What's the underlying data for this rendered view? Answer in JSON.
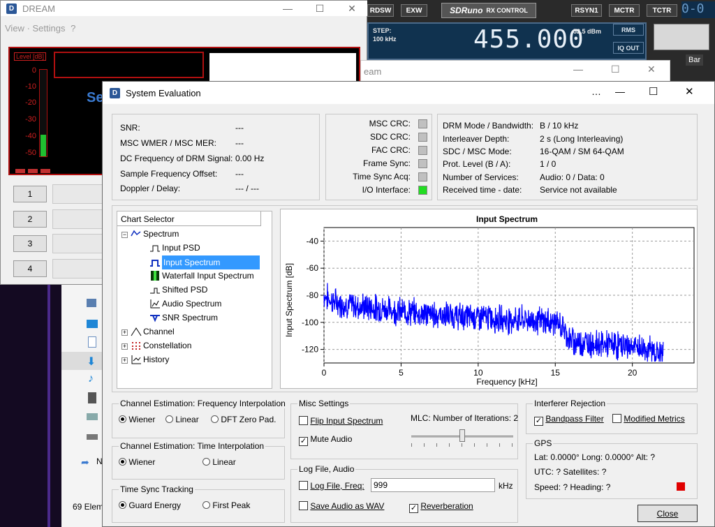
{
  "dream_window": {
    "title": "DREAM",
    "menu": [
      "View",
      "Settings",
      "?"
    ],
    "level_label": "Level [dB]",
    "level_ticks": [
      "0",
      "-10",
      "-20",
      "-30",
      "-40",
      "-50"
    ],
    "level_value_db": -45,
    "partial_text": "Se",
    "service_buttons": [
      "1",
      "2",
      "3",
      "4"
    ]
  },
  "sdruno": {
    "buttons_top": [
      "RDSW",
      "EXW"
    ],
    "logo": "SDRuno",
    "logo_sub": "RX CONTROL",
    "buttons_right": [
      "RSYN1",
      "MCTR",
      "TCTR"
    ],
    "step_label": "STEP:",
    "step_value": "100 kHz",
    "frequency": "455.000",
    "signal": "-52,5 dBm",
    "rms_button": "RMS",
    "iqout_button": "IQ OUT",
    "partial_bar": "Bar",
    "digits_partial": "0-0"
  },
  "second_dream_partial_title": "eam",
  "explorer": {
    "items_count": "69 Elem",
    "partial_letter": "N"
  },
  "system_evaluation": {
    "title": "System Evaluation",
    "stats": [
      {
        "label": "SNR:",
        "value": "---"
      },
      {
        "label": "MSC WMER / MSC MER:",
        "value": "---"
      },
      {
        "label": "DC Frequency of DRM Signal:",
        "value": "0.00 Hz"
      },
      {
        "label": "Sample Frequency Offset:",
        "value": "---"
      },
      {
        "label": "Doppler / Delay:",
        "value": "--- / ---"
      }
    ],
    "crc": [
      {
        "label": "MSC CRC:",
        "color": "#c0c0c0"
      },
      {
        "label": "SDC CRC:",
        "color": "#c0c0c0"
      },
      {
        "label": "FAC CRC:",
        "color": "#c0c0c0"
      },
      {
        "label": "Frame Sync:",
        "color": "#c0c0c0"
      },
      {
        "label": "Time Sync Acq:",
        "color": "#c0c0c0"
      },
      {
        "label": "I/O Interface:",
        "color": "#22dd22"
      }
    ],
    "drm_info": [
      {
        "label": "DRM Mode / Bandwidth:",
        "value": "B / 10 kHz"
      },
      {
        "label": "Interleaver Depth:",
        "value": "2 s (Long Interleaving)"
      },
      {
        "label": "SDC / MSC Mode:",
        "value": "16-QAM / SM 64-QAM"
      },
      {
        "label": "Prot. Level (B / A):",
        "value": "1 / 0"
      },
      {
        "label": "Number of Services:",
        "value": "Audio: 0 / Data: 0"
      },
      {
        "label": "Received time - date:",
        "value": "Service not available"
      }
    ],
    "chart_selector": {
      "header": "Chart Selector",
      "nodes": [
        {
          "label": "Spectrum",
          "expander": "-",
          "icon": "spectrum-icon"
        },
        {
          "label": "Input PSD",
          "icon": "input-psd-icon"
        },
        {
          "label": "Input Spectrum",
          "icon": "input-spectrum-icon",
          "selected": true
        },
        {
          "label": "Waterfall Input Spectrum",
          "icon": "waterfall-icon"
        },
        {
          "label": "Shifted PSD",
          "icon": "shifted-psd-icon"
        },
        {
          "label": "Audio Spectrum",
          "icon": "audio-spectrum-icon"
        },
        {
          "label": "SNR Spectrum",
          "icon": "snr-spectrum-icon"
        },
        {
          "label": "Channel",
          "expander": "+",
          "icon": "channel-icon"
        },
        {
          "label": "Constellation",
          "expander": "+",
          "icon": "constellation-icon"
        },
        {
          "label": "History",
          "expander": "+",
          "icon": "history-icon"
        }
      ]
    },
    "channel_freq_interp": {
      "title": "Channel Estimation: Frequency Interpolation",
      "options": [
        "Wiener",
        "Linear",
        "DFT Zero Pad."
      ],
      "selected": "Wiener"
    },
    "channel_time_interp": {
      "title": "Channel Estimation: Time Interpolation",
      "options": [
        "Wiener",
        "Linear"
      ],
      "selected": "Wiener"
    },
    "time_sync": {
      "title": "Time Sync Tracking",
      "options": [
        "Guard Energy",
        "First Peak"
      ],
      "selected": "Guard Energy"
    },
    "misc": {
      "title": "Misc Settings",
      "flip_label": "Flip Input Spectrum",
      "flip_checked": false,
      "mute_label": "Mute Audio",
      "mute_checked": true,
      "mlc_label": "MLC: Number of Iterations: 2",
      "mlc_fraction": 0.5
    },
    "log": {
      "title": "Log File, Audio",
      "logfile_label": "Log File, Freq:",
      "logfile_checked": false,
      "freq_value": "999",
      "freq_unit": "kHz",
      "save_audio_label": "Save Audio as WAV",
      "save_audio_checked": false,
      "reverb_label": "Reverberation",
      "reverb_checked": true
    },
    "interferer": {
      "title": "Interferer Rejection",
      "bandpass_label": "Bandpass Filter",
      "bandpass_checked": true,
      "modified_label": "Modified Metrics",
      "modified_checked": false
    },
    "gps": {
      "title": "GPS",
      "line1": "Lat: 0.0000°  Long: 0.0000°  Alt: ?",
      "line2": "UTC: ?  Satellites: ?",
      "line3": "Speed: ?  Heading: ?",
      "status_color": "#e00000"
    },
    "close_button": "Close"
  },
  "chart_data": {
    "type": "line",
    "title": "Input Spectrum",
    "xlabel": "Frequency [kHz]",
    "ylabel": "Input Spectrum [dB]",
    "xlim": [
      0,
      24
    ],
    "ylim": [
      -130,
      -30
    ],
    "xticks": [
      0,
      5,
      10,
      15,
      20
    ],
    "yticks": [
      -40,
      -60,
      -80,
      -100,
      -120
    ],
    "grid": true,
    "series": [
      {
        "color": "#0000ff",
        "x": [
          0,
          0.5,
          1,
          2,
          3,
          4,
          5,
          6,
          7,
          8,
          9,
          10,
          11,
          12,
          13,
          14,
          15,
          15.5,
          16,
          17,
          18,
          19,
          20,
          21,
          22
        ],
        "y": [
          -80,
          -84,
          -86,
          -88,
          -89,
          -90,
          -92,
          -93,
          -94,
          -95,
          -96,
          -96,
          -97,
          -98,
          -98,
          -99,
          -100,
          -104,
          -114,
          -115,
          -116,
          -117,
          -118,
          -120,
          -124
        ]
      }
    ]
  }
}
